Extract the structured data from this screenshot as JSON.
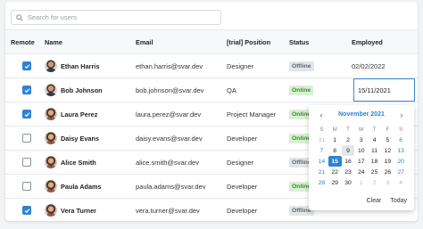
{
  "search": {
    "placeholder": "Search for users"
  },
  "columns": {
    "remote": "Remote",
    "name": "Name",
    "email": "Email",
    "position": "[trial] Position",
    "status": "Status",
    "employed": "Employed"
  },
  "rows": [
    {
      "remote": true,
      "name": "Ethan Harris",
      "email": "ethan.harris@svar.dev",
      "position": "Designer",
      "status": "Offline",
      "employed": "02/02/2022",
      "avatar": "male"
    },
    {
      "remote": true,
      "name": "Bob Johnson",
      "email": "bob.johnson@svar.dev",
      "position": "QA",
      "status": "Online",
      "employed": "15/11/2021",
      "avatar": "male"
    },
    {
      "remote": true,
      "name": "Laura Perez",
      "email": "laura.perez@svar.dev",
      "position": "Project Manager",
      "status": "Online",
      "employed": "",
      "avatar": "female"
    },
    {
      "remote": false,
      "name": "Daisy Evans",
      "email": "daisy.evans@svar.dev",
      "position": "Developer",
      "status": "Online",
      "employed": "",
      "avatar": "female"
    },
    {
      "remote": false,
      "name": "Alice Smith",
      "email": "alice.smith@svar.dev",
      "position": "Designer",
      "status": "Offline",
      "employed": "",
      "avatar": "female"
    },
    {
      "remote": false,
      "name": "Paula Adams",
      "email": "paula.adams@svar.dev",
      "position": "Developer",
      "status": "Online",
      "employed": "",
      "avatar": "female"
    },
    {
      "remote": true,
      "name": "Vera Turner",
      "email": "vera.turner@svar.dev",
      "position": "Developer",
      "status": "Offline",
      "employed": "",
      "avatar": "female"
    }
  ],
  "editor": {
    "value": "15/11/2021"
  },
  "calendar": {
    "title": "November 2021",
    "prev_icon": "chevron-left-icon",
    "next_icon": "chevron-right-icon",
    "weekdays": [
      "S",
      "M",
      "T",
      "W",
      "T",
      "F",
      "S"
    ],
    "weeks": [
      [
        {
          "d": "31",
          "o": true
        },
        {
          "d": "1"
        },
        {
          "d": "2"
        },
        {
          "d": "3"
        },
        {
          "d": "4"
        },
        {
          "d": "5"
        },
        {
          "d": "6"
        }
      ],
      [
        {
          "d": "7"
        },
        {
          "d": "8"
        },
        {
          "d": "9",
          "today": true
        },
        {
          "d": "10"
        },
        {
          "d": "11"
        },
        {
          "d": "12"
        },
        {
          "d": "13"
        }
      ],
      [
        {
          "d": "14"
        },
        {
          "d": "15",
          "sel": true
        },
        {
          "d": "16"
        },
        {
          "d": "17"
        },
        {
          "d": "18"
        },
        {
          "d": "19"
        },
        {
          "d": "20"
        }
      ],
      [
        {
          "d": "21"
        },
        {
          "d": "22"
        },
        {
          "d": "23"
        },
        {
          "d": "24"
        },
        {
          "d": "25"
        },
        {
          "d": "26"
        },
        {
          "d": "27"
        }
      ],
      [
        {
          "d": "28"
        },
        {
          "d": "29"
        },
        {
          "d": "30"
        },
        {
          "d": "1",
          "o": true
        },
        {
          "d": "2",
          "o": true
        },
        {
          "d": "3",
          "o": true
        },
        {
          "d": "4",
          "o": true
        }
      ]
    ],
    "clear_label": "Clear",
    "today_label": "Today"
  },
  "colors": {
    "accent": "#2f82d0",
    "online_bg": "#d8efd2",
    "online_fg": "#3d8a2e",
    "offline_bg": "#e3e5e8"
  }
}
